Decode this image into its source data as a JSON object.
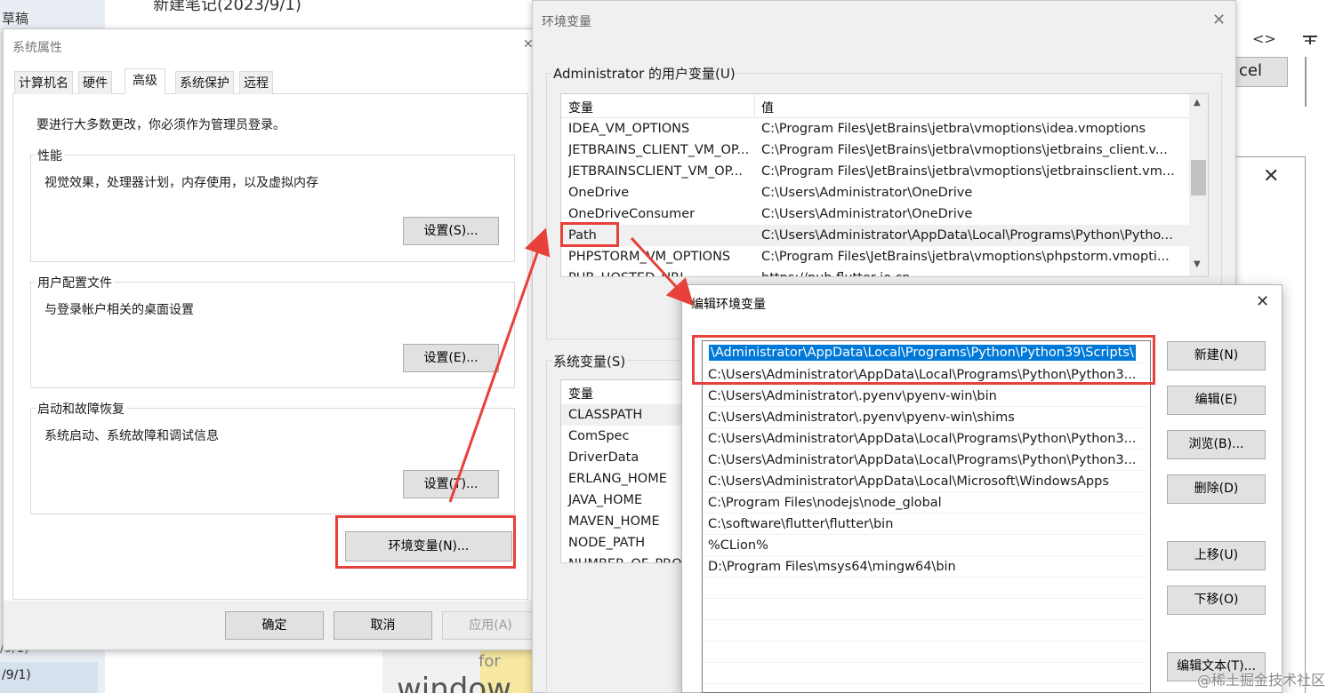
{
  "background": {
    "left_top": "草稿",
    "top_note": "新建笔记(2023/9/1)",
    "left_bottom1": "/9/1)",
    "left_bottom2": "/9/1)",
    "right_btn": "cel",
    "code_icon": "<>",
    "for_text": "for",
    "windows_text": "window",
    "watermark": "@稀土掘金技术社区"
  },
  "sysprops": {
    "title": "系统属性",
    "tabs": [
      "计算机名",
      "硬件",
      "高级",
      "系统保护",
      "远程"
    ],
    "admin_note": "要进行大多数更改，你必须作为管理员登录。",
    "performance": {
      "legend": "性能",
      "desc": "视觉效果，处理器计划，内存使用，以及虚拟内存",
      "button": "设置(S)..."
    },
    "profile": {
      "legend": "用户配置文件",
      "desc": "与登录帐户相关的桌面设置",
      "button": "设置(E)..."
    },
    "startup": {
      "legend": "启动和故障恢复",
      "desc": "系统启动、系统故障和调试信息",
      "button": "设置(T)..."
    },
    "env_button": "环境变量(N)...",
    "ok": "确定",
    "cancel": "取消",
    "apply": "应用(A)"
  },
  "envvars": {
    "title": "环境变量",
    "user_legend": "Administrator 的用户变量(U)",
    "col_var": "变量",
    "col_val": "值",
    "user_rows": [
      {
        "name": "IDEA_VM_OPTIONS",
        "value": "C:\\Program Files\\JetBrains\\jetbra\\vmoptions\\idea.vmoptions"
      },
      {
        "name": "JETBRAINS_CLIENT_VM_OP...",
        "value": "C:\\Program Files\\JetBrains\\jetbra\\vmoptions\\jetbrains_client.v..."
      },
      {
        "name": "JETBRAINSCLIENT_VM_OP...",
        "value": "C:\\Program Files\\JetBrains\\jetbra\\vmoptions\\jetbrainsclient.vm..."
      },
      {
        "name": "OneDrive",
        "value": "C:\\Users\\Administrator\\OneDrive"
      },
      {
        "name": "OneDriveConsumer",
        "value": "C:\\Users\\Administrator\\OneDrive"
      },
      {
        "name": "Path",
        "value": "C:\\Users\\Administrator\\AppData\\Local\\Programs\\Python\\Pytho..."
      },
      {
        "name": "PHPSTORM_VM_OPTIONS",
        "value": "C:\\Program Files\\JetBrains\\jetbra\\vmoptions\\phpstorm.vmopti..."
      },
      {
        "name": "PUB_HOSTED_URL",
        "value": "https://pub.flutter-io.cn"
      }
    ],
    "sys_legend": "系统变量(S)",
    "sys_col_var": "变量",
    "sys_rows": [
      "CLASSPATH",
      "ComSpec",
      "DriverData",
      "ERLANG_HOME",
      "JAVA_HOME",
      "MAVEN_HOME",
      "NODE_PATH",
      "NUMBER_OF_PRO"
    ]
  },
  "editenv": {
    "title": "编辑环境变量",
    "paths": [
      "\\Administrator\\AppData\\Local\\Programs\\Python\\Python39\\Scripts\\",
      "C:\\Users\\Administrator\\AppData\\Local\\Programs\\Python\\Python3...",
      "C:\\Users\\Administrator\\.pyenv\\pyenv-win\\bin",
      "C:\\Users\\Administrator\\.pyenv\\pyenv-win\\shims",
      "C:\\Users\\Administrator\\AppData\\Local\\Programs\\Python\\Python3...",
      "C:\\Users\\Administrator\\AppData\\Local\\Programs\\Python\\Python3...",
      "C:\\Users\\Administrator\\AppData\\Local\\Microsoft\\WindowsApps",
      "C:\\Program Files\\nodejs\\node_global",
      "C:\\software\\flutter\\flutter\\bin",
      "%CLion%",
      "D:\\Program Files\\msys64\\mingw64\\bin"
    ],
    "buttons": {
      "new": "新建(N)",
      "edit": "编辑(E)",
      "browse": "浏览(B)...",
      "delete": "删除(D)",
      "up": "上移(U)",
      "down": "下移(O)",
      "edit_text": "编辑文本(T)..."
    }
  },
  "colors": {
    "annotation_red": "#e8403a",
    "selection_blue": "#0078d7"
  }
}
